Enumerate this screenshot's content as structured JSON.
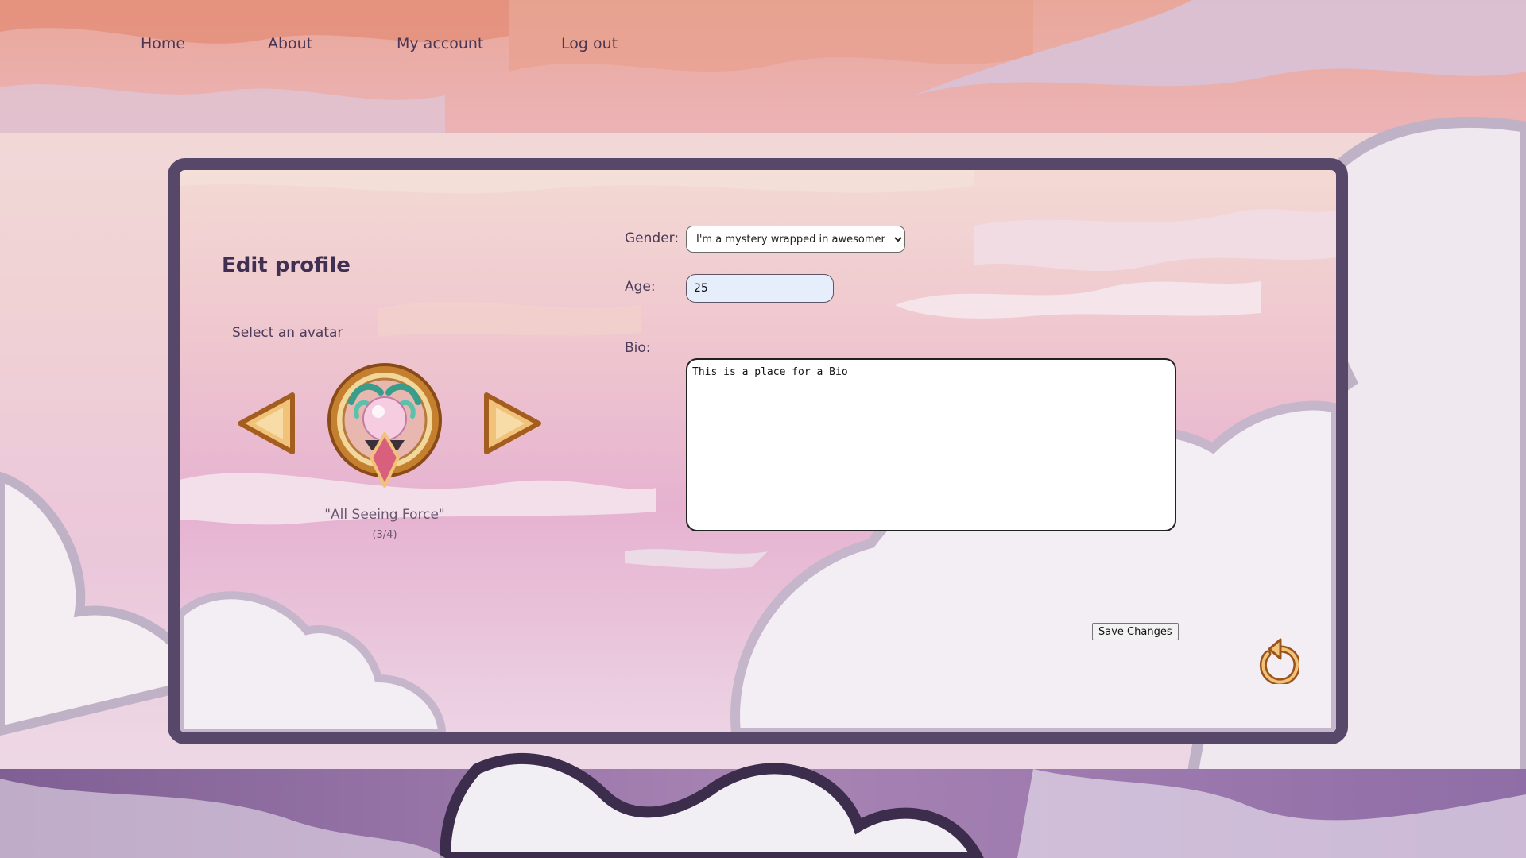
{
  "nav": {
    "home": "Home",
    "about": "About",
    "account": "My account",
    "logout": "Log out"
  },
  "profile": {
    "title": "Edit profile",
    "avatar_label": "Select an avatar",
    "avatar_name": "\"All Seeing Force\"",
    "avatar_index": "(3/4)",
    "prev_icon": "arrow-left-icon",
    "next_icon": "arrow-right-icon",
    "avatar_icon": "crystal-ball-medal-icon"
  },
  "form": {
    "gender_label": "Gender:",
    "gender_value": "I'm a mystery wrapped in awesomeness",
    "age_label": "Age:",
    "age_value": "25",
    "bio_label": "Bio:",
    "bio_value": "This is a place for a Bio",
    "save_label": "Save Changes",
    "reset_icon": "reset-icon"
  },
  "colors": {
    "frame": "#574869",
    "accent_gold": "#c97a2a",
    "nav_text": "#4a3652"
  }
}
